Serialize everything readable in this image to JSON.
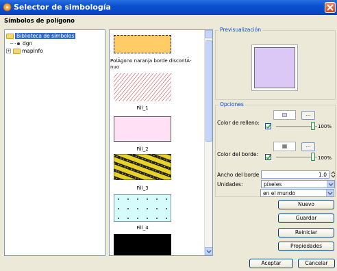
{
  "window": {
    "title": "Selector de simbología",
    "title_color": "#0a4fd0"
  },
  "section_title": "Símbolos de polígono",
  "tree": {
    "items": [
      {
        "label": "Biblioteca de símbolos",
        "selected": true
      },
      {
        "label": "dgn"
      },
      {
        "label": "mapInfo"
      }
    ]
  },
  "symbols": [
    {
      "label": "PolÃ­gono naranja borde discontÃ­nuo",
      "fill": "#ffcc66"
    },
    {
      "label": "Fill_1",
      "pattern": "diagonal-red-hatch"
    },
    {
      "label": "Fill_2",
      "fill": "#ffe0f5"
    },
    {
      "label": "Fill_3",
      "pattern": "yellow-black-stripes"
    },
    {
      "label": "Fill_4",
      "pattern": "cyan-dots"
    },
    {
      "label": "",
      "fill": "#000000"
    }
  ],
  "preview": {
    "label": "Previsualización",
    "fill_color": "#dcc8f6"
  },
  "options": {
    "label": "Opciones",
    "fill_color_label": "Color de relleno:",
    "fill_color_value": "#d8d0f8",
    "fill_checked": true,
    "fill_alpha_label": "100%",
    "border_color_label": "Color del borde:",
    "border_color_value": "#808080",
    "border_checked": true,
    "border_alpha_label": "100%",
    "dots_label": "...",
    "border_width_label": "Ancho del borde",
    "border_width_value": "1.0",
    "units_label": "Unidades:",
    "units_value": "píxeles",
    "world_value": "en el mundo"
  },
  "buttons": {
    "new": "Nuevo",
    "save": "Guardar",
    "reset": "Reiniciar",
    "properties": "Propiedades",
    "accept": "Aceptar",
    "cancel": "Cancelar"
  }
}
